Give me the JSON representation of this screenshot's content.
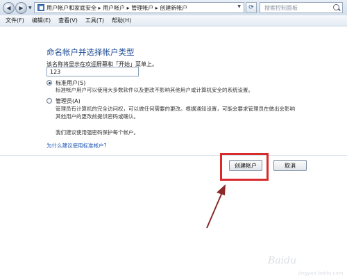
{
  "window": {
    "breadcrumb": "用户帐户和家庭安全 ▸ 用户帐户 ▸ 管理帐户 ▸ 创建新帐户",
    "search_placeholder": "搜索控制面板"
  },
  "menu": [
    "文件(F)",
    "编辑(E)",
    "查看(V)",
    "工具(T)",
    "帮助(H)"
  ],
  "page": {
    "title": "命名帐户并选择帐户类型",
    "hint": "该名称将显示在欢迎屏幕和「开始」菜单上。",
    "account_name": "123",
    "options": [
      {
        "label": "标准用户(S)",
        "selected": true,
        "desc_lines": [
          "标准帐户用户可以使用大多数软件以及更改不影响其他用户或计算机安全的系统设置。"
        ]
      },
      {
        "label": "管理员(A)",
        "selected": false,
        "desc_lines": [
          "管理员有计算机的完全访问权，可以做任何需要的更改。根据通知设置，可能会要求管理员在做出会影响",
          "其他用户的更改前提供密码或确认。"
        ]
      }
    ],
    "recommend": "我们建议使用强密码保护每个帐户。",
    "help_link": "为什么建议使用标准帐户?"
  },
  "buttons": {
    "create": "创建帐户",
    "cancel": "取消"
  },
  "colors": {
    "highlight": "#d82b2b",
    "arrow": "#8b2a2a",
    "title": "#1c4a96",
    "link": "#1a55b3"
  },
  "watermark": {
    "brand": "Baidu",
    "sub": "jingyan.baidu.com"
  }
}
